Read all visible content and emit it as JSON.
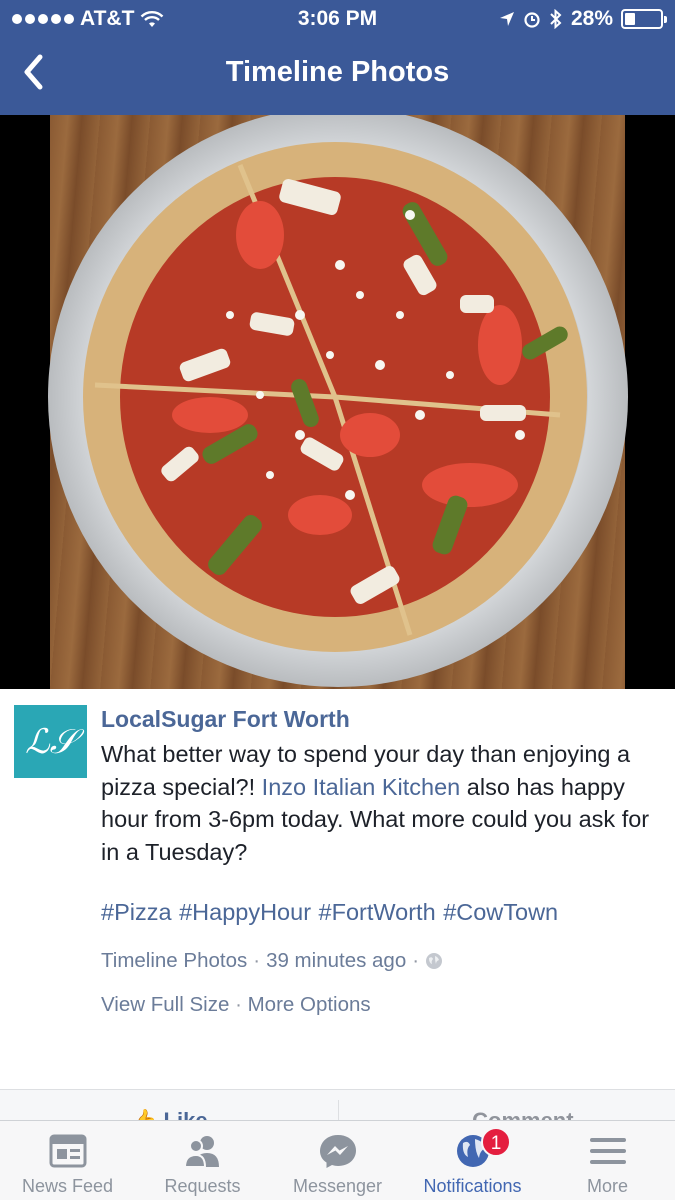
{
  "status_bar": {
    "carrier": "AT&T",
    "time": "3:06 PM",
    "battery": "28%",
    "battery_level": 0.28
  },
  "nav": {
    "title": "Timeline Photos"
  },
  "post": {
    "author": "LocalSugar Fort Worth",
    "text_before_link": "What better way to spend your day than enjoying a pizza special?! ",
    "link_text": "Inzo Italian Kitchen",
    "text_after_link": " also has happy hour from 3-6pm today. What more could you ask for in a Tuesday?",
    "hashtags": [
      "#Pizza",
      "#HappyHour",
      "#FortWorth",
      "#CowTown"
    ],
    "album": "Timeline Photos",
    "time_ago": "39 minutes ago",
    "separator": "·",
    "action_view": "View Full Size",
    "action_more": "More Options"
  },
  "action_bar": {
    "like": "Like",
    "comment": "Comment"
  },
  "tabbar": {
    "tabs": [
      {
        "label": "News Feed",
        "icon": "news-feed-icon"
      },
      {
        "label": "Requests",
        "icon": "requests-icon"
      },
      {
        "label": "Messenger",
        "icon": "messenger-icon"
      },
      {
        "label": "Notifications",
        "icon": "notifications-globe-icon",
        "badge": "1"
      },
      {
        "label": "More",
        "icon": "menu-icon"
      }
    ],
    "active_index": 3
  },
  "colors": {
    "header": "#3b5998",
    "link": "#4b6797",
    "active_tab": "#4267b2",
    "badge": "#e41e3f"
  }
}
